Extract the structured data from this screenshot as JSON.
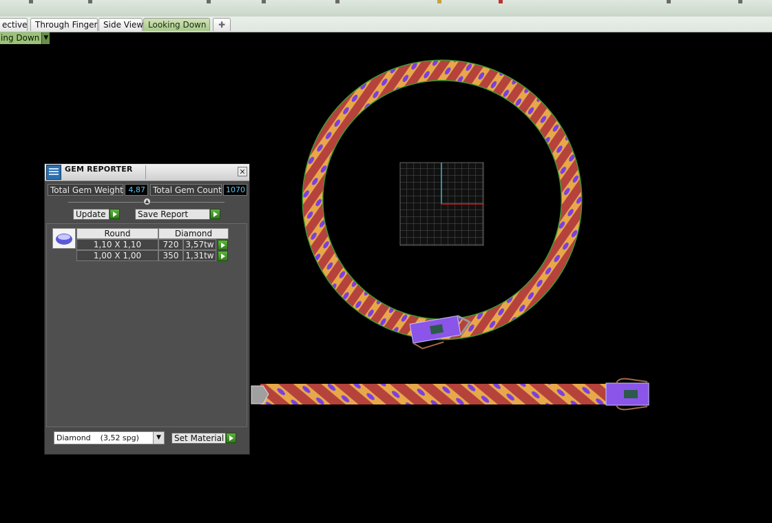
{
  "tabs": [
    {
      "label": "ective",
      "active": false
    },
    {
      "label": "Through Finger",
      "active": false
    },
    {
      "label": "Side View",
      "active": false
    },
    {
      "label": "Looking Down",
      "active": true
    }
  ],
  "add_tab_icon": "plus-icon",
  "view_selector": {
    "label": "ing Down",
    "icon": "dropdown-arrow-icon"
  },
  "gem_reporter": {
    "title": "GEM REPORTER",
    "total_gem_weight_label": "Total Gem Weight",
    "total_gem_weight": "4,87",
    "total_gem_count_label": "Total Gem Count",
    "total_gem_count": "1070",
    "update_label": "Update",
    "save_report_label": "Save Report",
    "table": {
      "headers": [
        "Round",
        "Diamond"
      ],
      "rows": [
        {
          "size": "1,10 X 1,10",
          "count": "720",
          "weight": "3,57tw"
        },
        {
          "size": "1,00 X 1,00",
          "count": "350",
          "weight": "1,31tw"
        }
      ]
    },
    "material_select": "Diamond    (3,52 spg)",
    "set_material_label": "Set Material"
  },
  "colors": {
    "toolbar": "#d6e0d6",
    "active_tab": "#b7d39a",
    "panel_bg": "#4a4a4a",
    "value_text": "#62c7f0",
    "chain_red": "#b5433c",
    "chain_gold": "#e8a84a",
    "gem_purple": "#7b3fe0"
  }
}
